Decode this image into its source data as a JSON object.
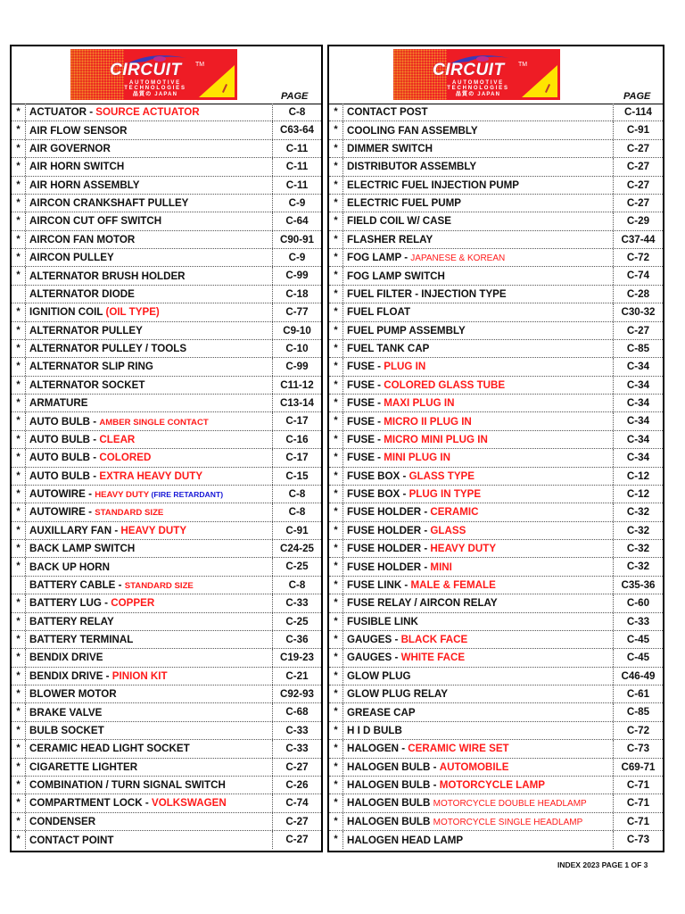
{
  "logo": {
    "brand": "CIRCUIT",
    "trademark": "TM",
    "line1": "AUTOMOTIVE",
    "line2": "TECHNOLOGIES",
    "line3": "品質の JAPAN"
  },
  "page_header": "PAGE",
  "colors": {
    "highlight_red": "#ff1a1a",
    "highlight_blue": "#1515d6"
  },
  "left": [
    {
      "star": "*",
      "name": "ACTUATOR - ",
      "hl": "SOURCE ACTUATOR",
      "page": "C-8"
    },
    {
      "star": "*",
      "name": "AIR FLOW SENSOR",
      "page": "C63-64"
    },
    {
      "star": "*",
      "name": "AIR GOVERNOR",
      "page": "C-11"
    },
    {
      "star": "*",
      "name": "AIR HORN  SWITCH",
      "page": "C-11"
    },
    {
      "star": "*",
      "name": "AIR HORN ASSEMBLY",
      "page": "C-11"
    },
    {
      "star": "*",
      "name": "AIRCON CRANKSHAFT PULLEY",
      "page": "C-9"
    },
    {
      "star": "*",
      "name": "AIRCON CUT OFF SWITCH",
      "page": "C-64"
    },
    {
      "star": "*",
      "name": "AIRCON FAN MOTOR",
      "page": "C90-91"
    },
    {
      "star": "*",
      "name": "AIRCON PULLEY",
      "page": "C-9"
    },
    {
      "star": "*",
      "name": "ALTERNATOR BRUSH HOLDER",
      "page": "C-99"
    },
    {
      "star": "",
      "name": "ALTERNATOR DIODE",
      "page": "C-18"
    },
    {
      "star": "*",
      "name": "IGNITION COIL ",
      "hl": "(OIL TYPE)",
      "page": "C-77"
    },
    {
      "star": "*",
      "name": "ALTERNATOR PULLEY",
      "page": "C9-10"
    },
    {
      "star": "*",
      "name": "ALTERNATOR PULLEY / TOOLS",
      "page": "C-10"
    },
    {
      "star": "*",
      "name": "ALTERNATOR SLIP RING",
      "page": "C-99"
    },
    {
      "star": "*",
      "name": "ALTERNATOR SOCKET",
      "page": "C11-12"
    },
    {
      "star": "*",
      "name": "ARMATURE",
      "page": "C13-14"
    },
    {
      "star": "*",
      "name": "AUTO BULB - ",
      "hl": "AMBER SINGLE CONTACT",
      "hl_style": "sm",
      "page": "C-17"
    },
    {
      "star": "*",
      "name": "AUTO BULB - ",
      "hl": "CLEAR",
      "page": "C-16"
    },
    {
      "star": "*",
      "name": "AUTO BULB - ",
      "hl": "COLORED",
      "page": "C-17"
    },
    {
      "star": "*",
      "name": "AUTO BULB - ",
      "hl": "EXTRA HEAVY DUTY",
      "page": "C-15"
    },
    {
      "star": "*",
      "name": "AUTOWIRE - ",
      "hl": "HEAVY DUTY",
      "hl_style": "sm",
      "hl2": " (FIRE RETARDANT)",
      "page": "C-8"
    },
    {
      "star": "*",
      "name": "AUTOWIRE - ",
      "hl": "STANDARD SIZE",
      "hl_style": "sm",
      "page": "C-8"
    },
    {
      "star": "*",
      "name": "AUXILLARY FAN - ",
      "hl": "HEAVY DUTY",
      "page": "C-91"
    },
    {
      "star": "*",
      "name": "BACK LAMP SWITCH",
      "page": "C24-25"
    },
    {
      "star": "*",
      "name": "BACK UP HORN",
      "page": "C-25"
    },
    {
      "star": "",
      "name": "BATTERY CABLE - ",
      "hl": "STANDARD SIZE",
      "hl_style": "sm",
      "page": "C-8"
    },
    {
      "star": "*",
      "name": "BATTERY LUG - ",
      "hl": "COPPER",
      "page": "C-33"
    },
    {
      "star": "*",
      "name": "BATTERY RELAY",
      "page": "C-25"
    },
    {
      "star": "*",
      "name": "BATTERY TERMINAL",
      "page": "C-36"
    },
    {
      "star": "*",
      "name": "BENDIX DRIVE",
      "page": "C19-23"
    },
    {
      "star": "*",
      "name": "BENDIX DRIVE - ",
      "hl": "PINION KIT",
      "page": "C-21"
    },
    {
      "star": "*",
      "name": "BLOWER  MOTOR",
      "page": "C92-93"
    },
    {
      "star": "*",
      "name": "BRAKE VALVE",
      "page": "C-68"
    },
    {
      "star": "*",
      "name": "BULB SOCKET",
      "page": "C-33"
    },
    {
      "star": "*",
      "name": "CERAMIC HEAD LIGHT SOCKET",
      "page": "C-33"
    },
    {
      "star": "*",
      "name": "CIGARETTE LIGHTER",
      "page": "C-27"
    },
    {
      "star": "*",
      "name": "COMBINATION / TURN SIGNAL SWITCH",
      "page": "C-26"
    },
    {
      "star": "*",
      "name": "COMPARTMENT LOCK - ",
      "hl": "VOLKSWAGEN",
      "page": "C-74"
    },
    {
      "star": "*",
      "name": "CONDENSER",
      "page": "C-27"
    },
    {
      "star": "*",
      "name": "CONTACT POINT",
      "page": "C-27"
    }
  ],
  "right": [
    {
      "star": "*",
      "name": "CONTACT POST",
      "page": "C-114"
    },
    {
      "star": "*",
      "name": "COOLING FAN ASSEMBLY",
      "page": "C-91"
    },
    {
      "star": "*",
      "name": "DIMMER SWITCH",
      "page": "C-27"
    },
    {
      "star": "*",
      "name": "DISTRIBUTOR ASSEMBLY",
      "page": "C-27"
    },
    {
      "star": "*",
      "name": "ELECTRIC FUEL INJECTION PUMP",
      "page": "C-27"
    },
    {
      "star": "*",
      "name": "ELECTRIC FUEL PUMP",
      "page": "C-27"
    },
    {
      "star": "*",
      "name": "FIELD COIL W/ CASE",
      "page": "C-29"
    },
    {
      "star": "*",
      "name": "FLASHER RELAY",
      "page": "C37-44"
    },
    {
      "star": "*",
      "name": "FOG LAMP - ",
      "hl": "JAPANESE & KOREAN",
      "hl_style": "thin",
      "page": "C-72"
    },
    {
      "star": "*",
      "name": "FOG LAMP SWITCH",
      "page": "C-74"
    },
    {
      "star": "*",
      "name": "FUEL FILTER - INJECTION TYPE",
      "page": "C-28"
    },
    {
      "star": "*",
      "name": "FUEL FLOAT",
      "page": "C30-32"
    },
    {
      "star": "*",
      "name": "FUEL PUMP ASSEMBLY",
      "page": "C-27"
    },
    {
      "star": "*",
      "name": "FUEL TANK CAP",
      "page": "C-85"
    },
    {
      "star": "*",
      "name": "FUSE -  ",
      "hl": "PLUG IN",
      "page": "C-34"
    },
    {
      "star": "*",
      "name": "FUSE - ",
      "hl": "COLORED GLASS TUBE",
      "page": "C-34"
    },
    {
      "star": "*",
      "name": "FUSE - ",
      "hl": "MAXI PLUG IN",
      "page": "C-34"
    },
    {
      "star": "*",
      "name": "FUSE - ",
      "hl": "MICRO II PLUG IN",
      "page": "C-34"
    },
    {
      "star": "*",
      "name": "FUSE - ",
      "hl": "MICRO MINI PLUG IN",
      "page": "C-34"
    },
    {
      "star": "*",
      "name": "FUSE -  ",
      "hl": "MINI PLUG IN",
      "page": "C-34"
    },
    {
      "star": "*",
      "name": "FUSE BOX - ",
      "hl": "GLASS TYPE",
      "page": "C-12"
    },
    {
      "star": "*",
      "name": "FUSE BOX - ",
      "hl": "PLUG IN TYPE",
      "page": "C-12"
    },
    {
      "star": "*",
      "name": "FUSE HOLDER - ",
      "hl": "CERAMIC",
      "page": "C-32"
    },
    {
      "star": "*",
      "name": "FUSE HOLDER -  ",
      "hl": "GLASS",
      "page": "C-32"
    },
    {
      "star": "*",
      "name": "FUSE HOLDER -  ",
      "hl": "HEAVY DUTY",
      "page": "C-32"
    },
    {
      "star": "*",
      "name": "FUSE HOLDER - ",
      "hl": "MINI",
      "page": "C-32"
    },
    {
      "star": "*",
      "name": "FUSE LINK -  ",
      "hl": "MALE & FEMALE",
      "page": "C35-36"
    },
    {
      "star": "*",
      "name": "FUSE RELAY / AIRCON RELAY",
      "page": "C-60"
    },
    {
      "star": "*",
      "name": "FUSIBLE LINK",
      "page": "C-33"
    },
    {
      "star": "*",
      "name": "GAUGES - ",
      "hl": "BLACK FACE",
      "page": "C-45"
    },
    {
      "star": "*",
      "name": "GAUGES - ",
      "hl": "WHITE FACE",
      "page": "C-45"
    },
    {
      "star": "*",
      "name": "GLOW PLUG",
      "page": "C46-49"
    },
    {
      "star": "*",
      "name": "GLOW PLUG RELAY",
      "page": "C-61"
    },
    {
      "star": "*",
      "name": "GREASE CAP",
      "page": "C-85"
    },
    {
      "star": "*",
      "name": "H I D  BULB",
      "page": "C-72"
    },
    {
      "star": "*",
      "name": "HALOGEN -  ",
      "hl": "CERAMIC WIRE SET",
      "page": "C-73"
    },
    {
      "star": "*",
      "name": "HALOGEN BULB  - ",
      "hl": "AUTOMOBILE",
      "page": "C69-71"
    },
    {
      "star": "*",
      "name": "HALOGEN BULB  -  ",
      "hl": "MOTORCYCLE LAMP",
      "page": "C-71"
    },
    {
      "star": "*",
      "name": "HALOGEN BULB  ",
      "hl": "MOTORCYCLE DOUBLE HEADLAMP",
      "hl_style": "thin",
      "page": "C-71"
    },
    {
      "star": "*",
      "name": "HALOGEN BULB  ",
      "hl": "MOTORCYCLE SINGLE HEADLAMP",
      "hl_style": "thin",
      "page": "C-71"
    },
    {
      "star": "*",
      "name": "HALOGEN HEAD LAMP",
      "page": "C-73"
    }
  ],
  "footer": "INDEX  2023 PAGE 1 OF 3"
}
